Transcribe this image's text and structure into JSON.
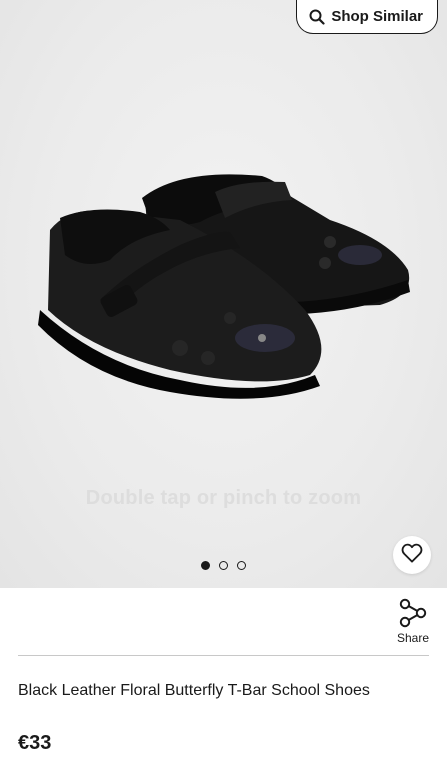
{
  "header": {
    "shop_similar_label": "Shop Similar",
    "shop_similar_icon": "search-icon"
  },
  "gallery": {
    "zoom_hint": "Double tap or pinch to zoom",
    "image_subject": "shoe-image",
    "favourite_icon": "heart-icon",
    "image_count": 3,
    "active_image_index": 0
  },
  "actions": {
    "share_label": "Share",
    "share_icon": "share-icon"
  },
  "product": {
    "title": "Black Leather Floral Butterfly T-Bar School Shoes",
    "price": "€33"
  },
  "colors": {
    "text": "#1a1a1a",
    "gallery_background": "#ebebeb",
    "divider": "#c8c8c8"
  }
}
